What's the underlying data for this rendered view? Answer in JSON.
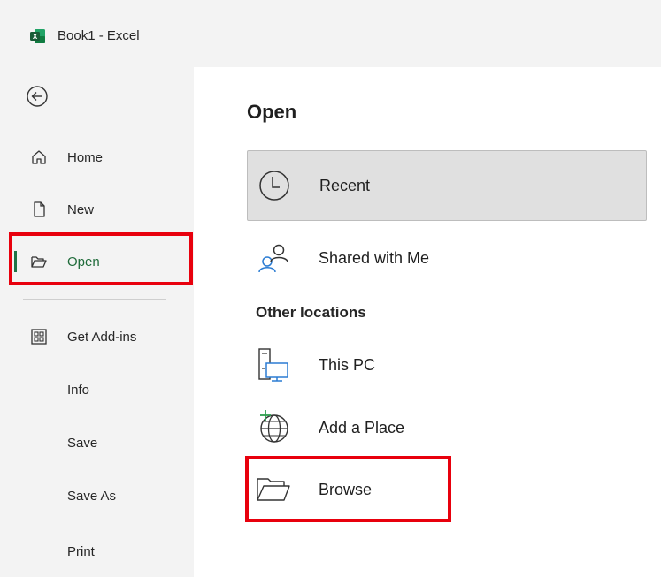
{
  "window": {
    "title": "Book1  -  Excel",
    "app_icon": "excel-logo-icon",
    "logo_letter": "X",
    "accent_color": "#217346"
  },
  "sidebar": {
    "back_icon": "back-arrow-icon",
    "items": [
      {
        "label": "Home",
        "icon": "home-icon"
      },
      {
        "label": "New",
        "icon": "new-document-icon"
      },
      {
        "label": "Open",
        "icon": "folder-open-icon",
        "active": true
      },
      {
        "label": "Get Add-ins",
        "icon": "add-ins-grid-icon"
      },
      {
        "label": "Info"
      },
      {
        "label": "Save"
      },
      {
        "label": "Save As"
      },
      {
        "label": "Print"
      }
    ]
  },
  "main": {
    "title": "Open",
    "locations": [
      {
        "label": "Recent",
        "icon": "clock-icon",
        "selected": true
      },
      {
        "label": "Shared with Me",
        "icon": "people-icon"
      }
    ],
    "other_locations_heading": "Other locations",
    "other_locations": [
      {
        "label": "This PC",
        "icon": "computer-icon"
      },
      {
        "label": "Add a Place",
        "icon": "globe-add-icon"
      },
      {
        "label": "Browse",
        "icon": "folder-browse-icon"
      }
    ]
  },
  "annotations": {
    "highlight_color": "#e8000d"
  }
}
